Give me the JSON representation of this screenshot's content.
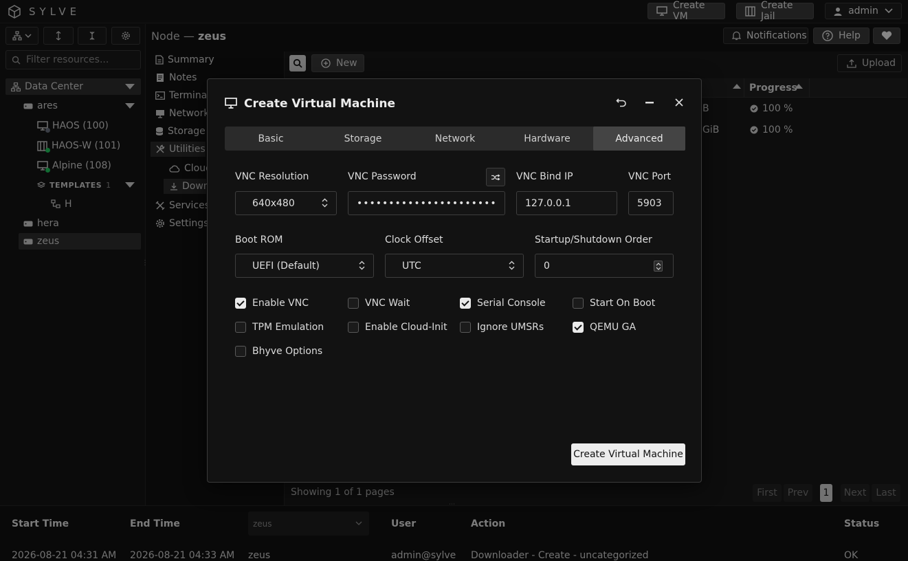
{
  "app": {
    "brand": "SYLVE"
  },
  "topbar": {
    "create_vm": "Create VM",
    "create_jail": "Create Jail",
    "user": "admin",
    "notifications": "Notifications",
    "help": "Help"
  },
  "sidebar": {
    "filter_placeholder": "Filter resources...",
    "datacenter": "Data Center",
    "nodes": [
      {
        "name": "ares"
      },
      {
        "name": "hera"
      },
      {
        "name": "zeus"
      }
    ],
    "vms": [
      {
        "name": "HAOS (100)",
        "status": "stopped"
      },
      {
        "name": "HAOS-W (101)",
        "status": "running"
      },
      {
        "name": "Alpine (108)",
        "status": "running"
      }
    ],
    "templates_label": "TEMPLATES",
    "templates_count": "1",
    "template_item": "H"
  },
  "node": {
    "prefix": "Node —",
    "name": "zeus"
  },
  "menu": {
    "summary": "Summary",
    "notes": "Notes",
    "terminal": "Terminal",
    "network": "Network",
    "storage": "Storage",
    "utilities": "Utilities",
    "cloud": "Cloud",
    "downloads": "Down",
    "services": "Services",
    "settings": "Settings"
  },
  "content": {
    "new_label": "New",
    "upload_label": "Upload",
    "col_progress": "Progress",
    "rows": [
      {
        "size": "B",
        "progress": "100 %"
      },
      {
        "size": "GiB",
        "progress": "100 %"
      }
    ],
    "pagination": {
      "showing": "Showing 1 of 1 pages",
      "first": "First",
      "prev": "Prev",
      "page": "1",
      "next": "Next",
      "last": "Last"
    }
  },
  "log": {
    "headers": {
      "start": "Start Time",
      "end": "End Time",
      "node_filter": "zeus",
      "user": "User",
      "action": "Action",
      "status": "Status"
    },
    "row": {
      "start": "2026-08-21 04:31 AM",
      "end": "2026-08-21 04:33 AM",
      "node": "zeus",
      "user": "admin@sylve",
      "action": "Downloader - Create - uncategorized",
      "status": "OK"
    }
  },
  "modal": {
    "title": "Create Virtual Machine",
    "tabs": [
      "Basic",
      "Storage",
      "Network",
      "Hardware",
      "Advanced"
    ],
    "active_tab": "Advanced",
    "fields": {
      "vnc_resolution_label": "VNC Resolution",
      "vnc_resolution": "640x480",
      "vnc_password_label": "VNC Password",
      "vnc_password": "••••••••••••••••••••••••",
      "vnc_bind_label": "VNC Bind IP",
      "vnc_bind": "127.0.0.1",
      "vnc_port_label": "VNC Port",
      "vnc_port": "5903",
      "boot_rom_label": "Boot ROM",
      "boot_rom": "UEFI (Default)",
      "clock_offset_label": "Clock Offset",
      "clock_offset": "UTC",
      "startup_order_label": "Startup/Shutdown Order",
      "startup_order": "0"
    },
    "checkboxes": [
      {
        "label": "Enable VNC",
        "checked": true
      },
      {
        "label": "VNC Wait",
        "checked": false
      },
      {
        "label": "Serial Console",
        "checked": true
      },
      {
        "label": "Start On Boot",
        "checked": false
      },
      {
        "label": "TPM Emulation",
        "checked": false
      },
      {
        "label": "Enable Cloud-Init",
        "checked": false
      },
      {
        "label": "Ignore UMSRs",
        "checked": false
      },
      {
        "label": "QEMU GA",
        "checked": true
      },
      {
        "label": "Bhyve Options",
        "checked": false
      }
    ],
    "submit": "Create Virtual Machine"
  },
  "colors": {
    "accent": "#ededed",
    "status_running": "#22c55e",
    "status_stopped": "#6b7280"
  }
}
